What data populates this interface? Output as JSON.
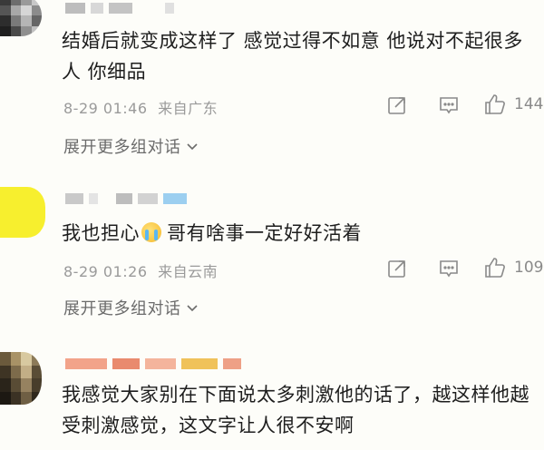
{
  "comments": [
    {
      "text": "结婚后就变成这样了 感觉过得不如意 他说对不起很多人 你细品",
      "time": "8-29 01:46",
      "location": "来自广东",
      "likes": "144",
      "expand": "展开更多组对话"
    },
    {
      "text_before_emoji": "我也担心",
      "text_after_emoji": "哥有啥事一定好好活着",
      "time": "8-29 01:26",
      "location": "来自云南",
      "likes": "109",
      "expand": "展开更多组对话"
    },
    {
      "text": "我感觉大家别在下面说太多刺激他的话了，越这样他越受刺激感觉，这文字让人很不安啊"
    }
  ],
  "icons": {
    "share": "share-icon",
    "comment": "comment-icon",
    "like": "thumbs-up-icon",
    "expand": "chevron-down-icon"
  },
  "colors": {
    "background": "#fdfdf9",
    "text": "#1e1e1e",
    "meta": "#9a9a9a",
    "icon": "#8a8a8a"
  }
}
